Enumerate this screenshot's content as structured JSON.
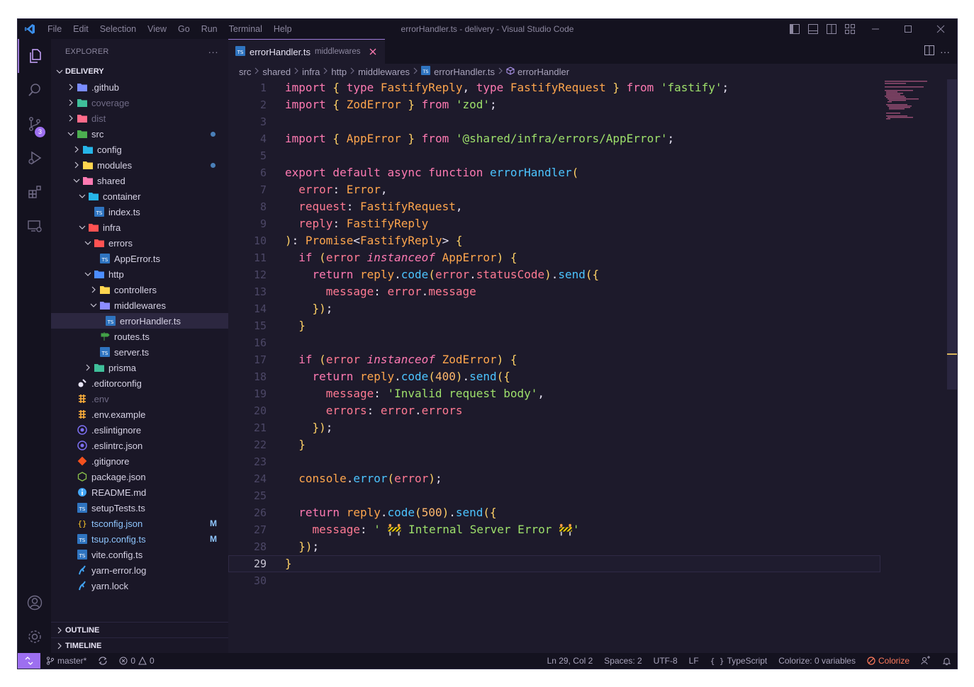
{
  "app": {
    "title": "errorHandler.ts - delivery - Visual Studio Code",
    "menu": [
      "File",
      "Edit",
      "Selection",
      "View",
      "Go",
      "Run",
      "Terminal",
      "Help"
    ]
  },
  "activity": {
    "source_control_badge": "3"
  },
  "sidebar": {
    "title": "EXPLORER",
    "more": "···",
    "root": "DELIVERY",
    "items": [
      {
        "label": "DELIVERY",
        "depth": 0,
        "type": "section"
      },
      {
        "label": ".github",
        "depth": 1,
        "type": "folder",
        "open": false,
        "color": "#7a8cff"
      },
      {
        "label": "coverage",
        "depth": 1,
        "type": "folder",
        "open": false,
        "color": "#3fbf9a",
        "dim": true
      },
      {
        "label": "dist",
        "depth": 1,
        "type": "folder",
        "open": false,
        "color": "#ff6b8a",
        "dim": true
      },
      {
        "label": "src",
        "depth": 1,
        "type": "folder",
        "open": true,
        "color": "#4caf50",
        "dot": true
      },
      {
        "label": "config",
        "depth": 2,
        "type": "folder",
        "open": false,
        "color": "#26b5e8"
      },
      {
        "label": "modules",
        "depth": 2,
        "type": "folder",
        "open": false,
        "color": "#ffd54f",
        "dot": true
      },
      {
        "label": "shared",
        "depth": 2,
        "type": "folder",
        "open": true,
        "color": "#ff7ab2"
      },
      {
        "label": "container",
        "depth": 3,
        "type": "folder",
        "open": true,
        "color": "#26b5e8"
      },
      {
        "label": "index.ts",
        "depth": 4,
        "type": "ts"
      },
      {
        "label": "infra",
        "depth": 3,
        "type": "folder",
        "open": true,
        "color": "#ff5252"
      },
      {
        "label": "errors",
        "depth": 4,
        "type": "folder",
        "open": true,
        "color": "#ff5252"
      },
      {
        "label": "AppError.ts",
        "depth": 5,
        "type": "ts"
      },
      {
        "label": "http",
        "depth": 4,
        "type": "folder",
        "open": true,
        "color": "#4c8dff"
      },
      {
        "label": "controllers",
        "depth": 5,
        "type": "folder",
        "open": false,
        "color": "#ffd54f"
      },
      {
        "label": "middlewares",
        "depth": 5,
        "type": "folder",
        "open": true,
        "color": "#8c8cff"
      },
      {
        "label": "errorHandler.ts",
        "depth": 6,
        "type": "ts",
        "selected": true
      },
      {
        "label": "routes.ts",
        "depth": 5,
        "type": "routes"
      },
      {
        "label": "server.ts",
        "depth": 5,
        "type": "ts"
      },
      {
        "label": "prisma",
        "depth": 4,
        "type": "folder",
        "open": false,
        "color": "#3fbf9a"
      },
      {
        "label": ".editorconfig",
        "depth": 1,
        "type": "editorconfig"
      },
      {
        "label": ".env",
        "depth": 1,
        "type": "env",
        "dim": true
      },
      {
        "label": ".env.example",
        "depth": 1,
        "type": "env"
      },
      {
        "label": ".eslintignore",
        "depth": 1,
        "type": "eslint"
      },
      {
        "label": ".eslintrc.json",
        "depth": 1,
        "type": "eslint"
      },
      {
        "label": ".gitignore",
        "depth": 1,
        "type": "git"
      },
      {
        "label": "package.json",
        "depth": 1,
        "type": "node"
      },
      {
        "label": "README.md",
        "depth": 1,
        "type": "info"
      },
      {
        "label": "setupTests.ts",
        "depth": 1,
        "type": "ts"
      },
      {
        "label": "tsconfig.json",
        "depth": 1,
        "type": "json",
        "modified": "M"
      },
      {
        "label": "tsup.config.ts",
        "depth": 1,
        "type": "ts",
        "modified": "M"
      },
      {
        "label": "vite.config.ts",
        "depth": 1,
        "type": "ts"
      },
      {
        "label": "yarn-error.log",
        "depth": 1,
        "type": "yarn"
      },
      {
        "label": "yarn.lock",
        "depth": 1,
        "type": "yarn"
      }
    ],
    "outline": "OUTLINE",
    "timeline": "TIMELINE"
  },
  "editor": {
    "tab": {
      "name": "errorHandler.ts",
      "description": "middlewares"
    },
    "breadcrumb": [
      "src",
      "shared",
      "infra",
      "http",
      "middlewares",
      "errorHandler.ts",
      "errorHandler"
    ],
    "current_line": 29,
    "lines": [
      [
        [
          "k",
          "import"
        ],
        [
          "y",
          " { "
        ],
        [
          "k",
          "type "
        ],
        [
          "t",
          "FastifyReply"
        ],
        [
          "d",
          ", "
        ],
        [
          "k",
          "type "
        ],
        [
          "t",
          "FastifyRequest"
        ],
        [
          "y",
          " } "
        ],
        [
          "k",
          "from "
        ],
        [
          "s",
          "'fastify'"
        ],
        [
          "d",
          ";"
        ]
      ],
      [
        [
          "k",
          "import"
        ],
        [
          "y",
          " { "
        ],
        [
          "t",
          "ZodError"
        ],
        [
          "y",
          " } "
        ],
        [
          "k",
          "from "
        ],
        [
          "s",
          "'zod'"
        ],
        [
          "d",
          ";"
        ]
      ],
      [],
      [
        [
          "k",
          "import"
        ],
        [
          "y",
          " { "
        ],
        [
          "t",
          "AppError"
        ],
        [
          "y",
          " } "
        ],
        [
          "k",
          "from "
        ],
        [
          "s",
          "'@shared/infra/errors/AppError'"
        ],
        [
          "d",
          ";"
        ]
      ],
      [],
      [
        [
          "k",
          "export default async function "
        ],
        [
          "f",
          "errorHandler"
        ],
        [
          "y",
          "("
        ]
      ],
      [
        [
          "d",
          "  "
        ],
        [
          "p",
          "error"
        ],
        [
          "d",
          ": "
        ],
        [
          "t",
          "Error"
        ],
        [
          "d",
          ","
        ]
      ],
      [
        [
          "d",
          "  "
        ],
        [
          "p",
          "request"
        ],
        [
          "d",
          ": "
        ],
        [
          "t",
          "FastifyRequest"
        ],
        [
          "d",
          ","
        ]
      ],
      [
        [
          "d",
          "  "
        ],
        [
          "p",
          "reply"
        ],
        [
          "d",
          ": "
        ],
        [
          "t",
          "FastifyReply"
        ]
      ],
      [
        [
          "y",
          ")"
        ],
        [
          "d",
          ": "
        ],
        [
          "t",
          "Promise"
        ],
        [
          "d",
          "<"
        ],
        [
          "t",
          "FastifyReply"
        ],
        [
          "d",
          "> "
        ],
        [
          "y",
          "{"
        ]
      ],
      [
        [
          "d",
          "  "
        ],
        [
          "k",
          "if "
        ],
        [
          "y",
          "("
        ],
        [
          "p",
          "error "
        ],
        [
          "i",
          "instanceof "
        ],
        [
          "t",
          "AppError"
        ],
        [
          "y",
          ") {"
        ]
      ],
      [
        [
          "d",
          "    "
        ],
        [
          "k",
          "return "
        ],
        [
          "t",
          "reply"
        ],
        [
          "d",
          "."
        ],
        [
          "f",
          "code"
        ],
        [
          "y",
          "("
        ],
        [
          "p",
          "error"
        ],
        [
          "d",
          "."
        ],
        [
          "p",
          "statusCode"
        ],
        [
          "y",
          ")"
        ],
        [
          "d",
          "."
        ],
        [
          "f",
          "send"
        ],
        [
          "y",
          "({"
        ]
      ],
      [
        [
          "d",
          "      "
        ],
        [
          "p",
          "message"
        ],
        [
          "d",
          ": "
        ],
        [
          "p",
          "error"
        ],
        [
          "d",
          "."
        ],
        [
          "p",
          "message"
        ]
      ],
      [
        [
          "d",
          "    "
        ],
        [
          "y",
          "})"
        ],
        [
          "d",
          ";"
        ]
      ],
      [
        [
          "d",
          "  "
        ],
        [
          "y",
          "}"
        ]
      ],
      [],
      [
        [
          "d",
          "  "
        ],
        [
          "k",
          "if "
        ],
        [
          "y",
          "("
        ],
        [
          "p",
          "error "
        ],
        [
          "i",
          "instanceof "
        ],
        [
          "t",
          "ZodError"
        ],
        [
          "y",
          ") {"
        ]
      ],
      [
        [
          "d",
          "    "
        ],
        [
          "k",
          "return "
        ],
        [
          "t",
          "reply"
        ],
        [
          "d",
          "."
        ],
        [
          "f",
          "code"
        ],
        [
          "y",
          "("
        ],
        [
          "n",
          "400"
        ],
        [
          "y",
          ")"
        ],
        [
          "d",
          "."
        ],
        [
          "f",
          "send"
        ],
        [
          "y",
          "({"
        ]
      ],
      [
        [
          "d",
          "      "
        ],
        [
          "p",
          "message"
        ],
        [
          "d",
          ": "
        ],
        [
          "s",
          "'Invalid request body'"
        ],
        [
          "d",
          ","
        ]
      ],
      [
        [
          "d",
          "      "
        ],
        [
          "p",
          "errors"
        ],
        [
          "d",
          ": "
        ],
        [
          "p",
          "error"
        ],
        [
          "d",
          "."
        ],
        [
          "p",
          "errors"
        ]
      ],
      [
        [
          "d",
          "    "
        ],
        [
          "y",
          "})"
        ],
        [
          "d",
          ";"
        ]
      ],
      [
        [
          "d",
          "  "
        ],
        [
          "y",
          "}"
        ]
      ],
      [],
      [
        [
          "d",
          "  "
        ],
        [
          "t",
          "console"
        ],
        [
          "d",
          "."
        ],
        [
          "f",
          "error"
        ],
        [
          "y",
          "("
        ],
        [
          "p",
          "error"
        ],
        [
          "y",
          ")"
        ],
        [
          "d",
          ";"
        ]
      ],
      [],
      [
        [
          "d",
          "  "
        ],
        [
          "k",
          "return "
        ],
        [
          "t",
          "reply"
        ],
        [
          "d",
          "."
        ],
        [
          "f",
          "code"
        ],
        [
          "y",
          "("
        ],
        [
          "n",
          "500"
        ],
        [
          "y",
          ")"
        ],
        [
          "d",
          "."
        ],
        [
          "f",
          "send"
        ],
        [
          "y",
          "({"
        ]
      ],
      [
        [
          "d",
          "    "
        ],
        [
          "p",
          "message"
        ],
        [
          "d",
          ": "
        ],
        [
          "s",
          "' 🚧 Internal Server Error 🚧'"
        ]
      ],
      [
        [
          "d",
          "  "
        ],
        [
          "y",
          "})"
        ],
        [
          "d",
          ";"
        ]
      ],
      [
        [
          "y",
          "}"
        ]
      ],
      []
    ]
  },
  "status": {
    "branch": "master*",
    "problems_errors": "0",
    "problems_warnings": "0",
    "cursor": "Ln 29, Col 2",
    "spaces": "Spaces: 2",
    "encoding": "UTF-8",
    "eol": "LF",
    "language": "TypeScript",
    "colorize_vars": "Colorize: 0 variables",
    "colorize": "Colorize"
  }
}
